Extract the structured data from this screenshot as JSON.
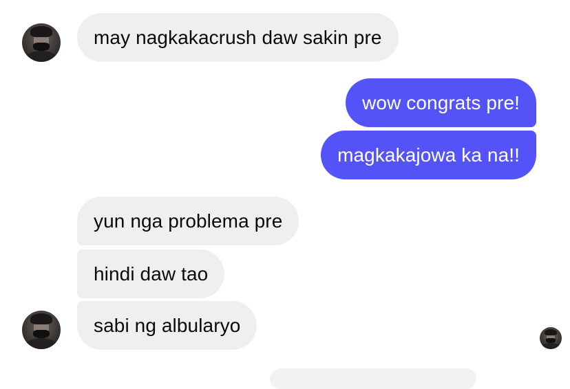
{
  "chat": {
    "messages": [
      {
        "sender": "other",
        "text": "may nagkakacrush daw sakin pre"
      },
      {
        "sender": "me",
        "text": "wow congrats pre!"
      },
      {
        "sender": "me",
        "text": "magkakajowa ka na!!"
      },
      {
        "sender": "other",
        "text": "yun nga problema pre"
      },
      {
        "sender": "other",
        "text": "hindi daw tao"
      },
      {
        "sender": "other",
        "text": "sabi ng albularyo"
      }
    ]
  },
  "colors": {
    "outgoing_bubble": "#5353f7",
    "incoming_bubble": "#efeff1",
    "incoming_text": "#0a0a0a",
    "outgoing_text": "#ffffff"
  },
  "icons": {
    "avatar": "contact-avatar-icon",
    "read_receipt": "read-receipt-avatar-icon"
  }
}
